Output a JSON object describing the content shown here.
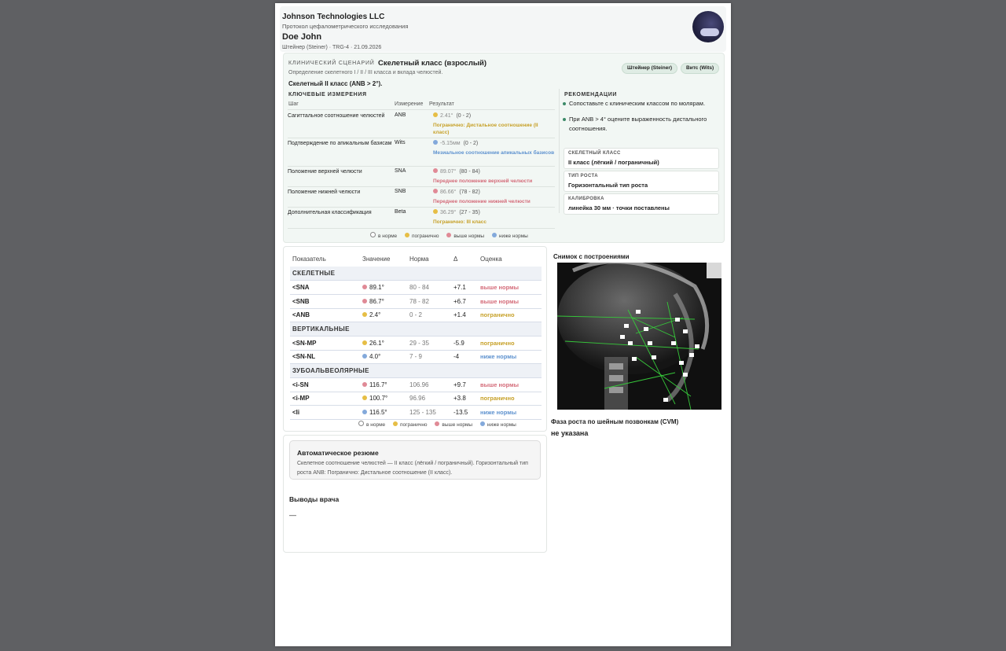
{
  "header": {
    "company": "Johnson Technologies LLC",
    "protocol": "Протокол цефалометрического исследования",
    "patient": "Doe John",
    "meta": "Штейнер (Steiner) · TRG-4 · 21.09.2026",
    "logo_icon": "moon-cloud-logo"
  },
  "scenario": {
    "label": "КЛИНИЧЕСКИЙ СЦЕНАРИЙ",
    "title": "Скелетный класс (взрослый)",
    "description": "Определение скелетного I / II / III класса и вклада челюстей.",
    "result": "Скелетный II класс (ANB > 2°).",
    "pills": [
      "Штейнер (Steiner)",
      "Витс (Wits)"
    ]
  },
  "key_measurements": {
    "label": "КЛЮЧЕВЫЕ ИЗМЕРЕНИЯ",
    "headers": {
      "step": "Шаг",
      "measure": "Измерение",
      "result": "Результат"
    },
    "rows": [
      {
        "step": "Сагиттальное соотношение челюстей",
        "measure": "ANB",
        "value": "2.41°",
        "norm": "(0 - 2)",
        "status": "Погранично: Дистальное соотношение (II класс)",
        "color": "#e6be45"
      },
      {
        "step": "Подтверждение по апикальным базисам",
        "measure": "Wits",
        "value": "-5.15мм",
        "norm": "(0 - 2)",
        "status": "Мезиальное соотношение апикальных базисов",
        "color": "#83a9db"
      },
      {
        "step": "Положение верхней челюсти",
        "measure": "SNA",
        "value": "89.07°",
        "norm": "(80 - 84)",
        "status": "Переднее положение верхней челюсти",
        "color": "#e08a96"
      },
      {
        "step": "Положение нижней челюсти",
        "measure": "SNB",
        "value": "86.66°",
        "norm": "(78 - 82)",
        "status": "Переднее положение нижней челюсти",
        "color": "#e08a96"
      },
      {
        "step": "Дополнительная классификация",
        "measure": "Beta",
        "value": "36.29°",
        "norm": "(27 - 35)",
        "status": "Погранично: III класс",
        "color": "#e6be45"
      }
    ]
  },
  "legend": {
    "normal": "в норме",
    "borderline": "погранично",
    "above": "выше нормы",
    "below": "ниже нормы"
  },
  "recommendations": {
    "label": "РЕКОМЕНДАЦИИ",
    "items": [
      "Сопоставьте с клиническим классом по молярам.",
      "При ANB > 4° оцените выраженность дистального соотношения."
    ],
    "boxes": [
      {
        "label": "СКЕЛЕТНЫЙ КЛАСС",
        "value": "II класс (лёгкий / пограничный)"
      },
      {
        "label": "ТИП РОСТА",
        "value": "Горизонтальный тип роста"
      },
      {
        "label": "КАЛИБРОВКА",
        "value": "линейка 30 мм · точки поставлены"
      }
    ]
  },
  "table": {
    "headers": [
      "Показатель",
      "Значение",
      "Норма",
      "Δ",
      "Оценка"
    ],
    "groups": [
      {
        "name": "СКЕЛЕТНЫЕ",
        "rows": [
          {
            "name": "<SNA",
            "value": "89.1°",
            "norm": "80 - 84",
            "delta": "+7.1",
            "grade": "выше нормы",
            "level": "above"
          },
          {
            "name": "<SNB",
            "value": "86.7°",
            "norm": "78 - 82",
            "delta": "+6.7",
            "grade": "выше нормы",
            "level": "above"
          },
          {
            "name": "<ANB",
            "value": "2.4°",
            "norm": "0 - 2",
            "delta": "+1.4",
            "grade": "погранично",
            "level": "borderline"
          }
        ]
      },
      {
        "name": "ВЕРТИКАЛЬНЫЕ",
        "rows": [
          {
            "name": "<SN-MP",
            "value": "26.1°",
            "norm": "29 - 35",
            "delta": "-5.9",
            "grade": "погранично",
            "level": "borderline"
          },
          {
            "name": "<SN-NL",
            "value": "4.0°",
            "norm": "7 - 9",
            "delta": "-4",
            "grade": "ниже нормы",
            "level": "below"
          }
        ]
      },
      {
        "name": "ЗУБОАЛЬВЕОЛЯРНЫЕ",
        "rows": [
          {
            "name": "<i-SN",
            "value": "116.7°",
            "norm": "106.96",
            "delta": "+9.7",
            "grade": "выше нормы",
            "level": "above"
          },
          {
            "name": "<i-MP",
            "value": "100.7°",
            "norm": "96.96",
            "delta": "+3.8",
            "grade": "погранично",
            "level": "borderline"
          },
          {
            "name": "<Ii",
            "value": "116.5°",
            "norm": "125 - 135",
            "delta": "-13.5",
            "grade": "ниже нормы",
            "level": "below"
          }
        ]
      }
    ]
  },
  "level_colors": {
    "normal": "#ffffff",
    "borderline": "#e6be45",
    "above": "#e08a96",
    "below": "#83a9db"
  },
  "level_text_colors": {
    "borderline": "#c7a129",
    "above": "#d46b79",
    "below": "#5e92cf"
  },
  "xray": {
    "title": "Снимок с построениями",
    "cvm_title": "Фаза роста по шейным позвонкам (CVM)",
    "cvm_value": "не указана"
  },
  "summary": {
    "title": "Автоматическое резюме",
    "text": "Скелетное соотношение челюстей — II класс (лёгкий / пограничный). Горизонтальный тип роста ANB: Погранично: Дистальное соотношение (II класс).",
    "doctor_title": "Выводы врача",
    "doctor_value": "—"
  }
}
